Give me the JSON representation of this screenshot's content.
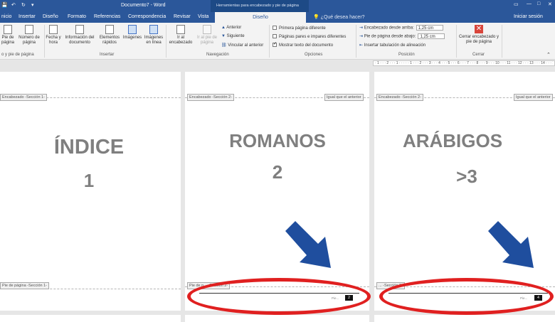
{
  "window": {
    "title": "Documento7 - Word",
    "context_title": "Herramientas para encabezado y pie de página",
    "controls": [
      "▭",
      "—",
      "□",
      "✕"
    ]
  },
  "tabs": [
    "nicio",
    "Insertar",
    "Diseño",
    "Formato",
    "Referencias",
    "Correspondencia",
    "Revisar",
    "Vista",
    "Diseño"
  ],
  "tellme": "¿Qué desea hacer?",
  "signin": "Iniciar sesión",
  "ribbon": {
    "hf_group": {
      "pie_label": "Pie de página",
      "numero_label": "Número de página",
      "group_label": "o y pie de página"
    },
    "insertar": {
      "fecha": "Fecha y hora",
      "info": "Información del documento",
      "elementos": "Elementos rápidos",
      "imagenes": "Imágenes",
      "imagenes_linea": "Imágenes en línea",
      "group_label": "Insertar"
    },
    "navegacion": {
      "ir_encabezado": "Ir al encabezado",
      "ir_pie": "Ir al pie de página",
      "anterior": "Anterior",
      "siguiente": "Siguiente",
      "vincular": "Vincular al anterior",
      "group_label": "Navegación"
    },
    "opciones": {
      "primera": "Primera página diferente",
      "pares": "Páginas pares e impares diferentes",
      "mostrar": "Mostrar texto del documento",
      "group_label": "Opciones",
      "mostrar_checked": true
    },
    "posicion": {
      "encabezado_label": "Encabezado desde arriba:",
      "encabezado_value": "1,25 cm",
      "pie_label": "Pie de página desde abajo:",
      "pie_value": "1,25 cm",
      "tabulacion": "Insertar tabulación de alineación",
      "group_label": "Posición"
    },
    "cerrar": {
      "label": "Cerrar encabezado y pie de página",
      "group_label": "Cerrar"
    }
  },
  "ruler": "· 1 · · · 2 · · · 1 · · · · · 1 · · · 2 · · · 3 · · · 4 · · · 5 · · · 6 · · · 7 · · · 8 · · · 9 · · · 10 · · · 11 · · · 12 · · · 13 · · · 14 · · · 15 · · · 16 · · · 17 · · · 18",
  "pages": [
    {
      "header_tag": "Encabezado -Sección 1-",
      "title": "ÍNDICE",
      "number": "1",
      "footer_tag": "Pie de página -Sección 1-"
    },
    {
      "header_tag": "Encabezado -Sección 2-",
      "same_tag": "Igual que el anterior",
      "title": "ROMANOS",
      "number": "2",
      "footer_tag": "Pie de p... -Sección 2-",
      "page_label": "Pie...",
      "page_num": "2"
    },
    {
      "header_tag": "Encabezado -Sección 2-",
      "same_tag": "Igual que el anterior",
      "title": "ARÁBIGOS",
      "number": ">3",
      "footer_tag": "... -Sección 2-",
      "page_label": "Pie...",
      "page_num": "4"
    }
  ],
  "colors": {
    "word_blue": "#2b579a",
    "arrow_blue": "#1f4e9e",
    "highlight_red": "#e02020",
    "title_gray": "#7f7f7f"
  }
}
